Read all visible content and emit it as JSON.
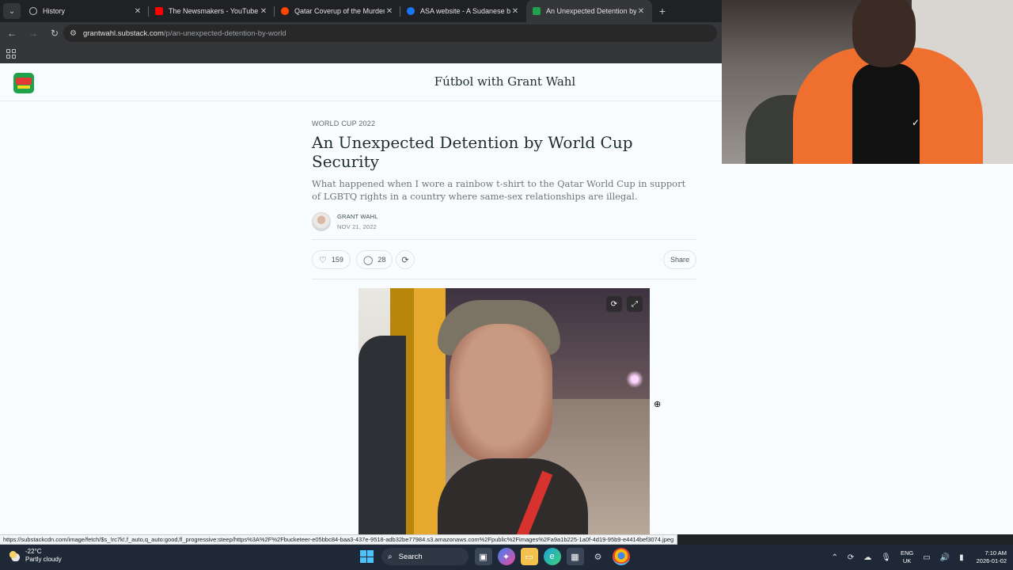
{
  "browser": {
    "tabs": [
      {
        "label": "History",
        "favicon_color": "#202124",
        "icon": "history-icon"
      },
      {
        "label": "The Newsmakers - YouTube",
        "favicon_color": "#ff0000",
        "icon": "youtube-icon"
      },
      {
        "label": "Qatar Coverup of the Murder o",
        "favicon_color": "#ff4500",
        "icon": "reddit-icon"
      },
      {
        "label": "ASA website - A Sudanese bod",
        "favicon_color": "#1877f2",
        "icon": "facebook-icon"
      },
      {
        "label": "An Unexpected Detention by W",
        "favicon_color": "#1fa34a",
        "icon": "substack-icon",
        "active": true
      }
    ],
    "new_tab_glyph": "+",
    "url_host": "grantwahl.substack.com",
    "url_path": "/p/an-unexpected-detention-by-world"
  },
  "site": {
    "title": "Fútbol with Grant Wahl"
  },
  "article": {
    "kicker": "WORLD CUP 2022",
    "headline": "An Unexpected Detention by World Cup Security",
    "dek": "What happened when I wore a rainbow t-shirt to the Qatar World Cup in support of LGBTQ rights in a country where same-sex relationships are illegal.",
    "author": "GRANT WAHL",
    "date": "NOV 21, 2022",
    "likes": "159",
    "comments": "28",
    "share_label": "Share"
  },
  "status_url": "https://substackcdn.com/image/fetch/$s_!rc7k!,f_auto,q_auto:good,fl_progressive:steep/https%3A%2F%2Fbucketeer-e05bbc84-baa3-437e-9518-adb32be77984.s3.amazonaws.com%2Fpublic%2Fimages%2Fa9a1b225-1a0f-4d19-95b9-e4414bef3074.jpeg",
  "taskbar": {
    "temperature": "-22°C",
    "weather": "Partly cloudy",
    "search_label": "Search",
    "lang_primary": "ENG",
    "lang_secondary": "UK",
    "time": "7:10 AM",
    "date": "2026-01-02"
  }
}
